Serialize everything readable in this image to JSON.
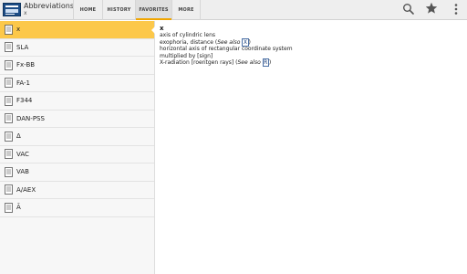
{
  "app": {
    "title": "Abbreviations",
    "subtitle": "x"
  },
  "tabs": [
    {
      "label": "HOME"
    },
    {
      "label": "HISTORY"
    },
    {
      "label": "FAVORITES",
      "selected": true
    },
    {
      "label": "MORE"
    }
  ],
  "icons": {
    "search": "search-icon",
    "star": "star-icon",
    "overflow": "overflow-menu-icon",
    "document": "document-icon"
  },
  "colors": {
    "selected_row": "#fcc84a",
    "tab_indicator": "#f0a500",
    "actionbar": "#eeeeee"
  },
  "list": [
    {
      "label": "x",
      "selected": true
    },
    {
      "label": "SLA"
    },
    {
      "label": "Fx-BB"
    },
    {
      "label": "FA-1"
    },
    {
      "label": "F344"
    },
    {
      "label": "DAN-PSS"
    },
    {
      "label": "Δ"
    },
    {
      "label": "VAC"
    },
    {
      "label": "VAB"
    },
    {
      "label": "A/AEX"
    },
    {
      "label": "Ā"
    }
  ],
  "entry": {
    "term": "x",
    "definitions": [
      {
        "text": "axis of cylindric lens"
      },
      {
        "text": "exophoria, distance (",
        "see_also": "See also",
        "ref": "X",
        "suffix": ")"
      },
      {
        "text": "horizontal axis of rectangular coordinate system"
      },
      {
        "text": "multiplied by [sign]"
      },
      {
        "text": "X-radiation [roentgen rays] (",
        "see_also": "See also",
        "ref": "R",
        "suffix": ")"
      }
    ]
  }
}
